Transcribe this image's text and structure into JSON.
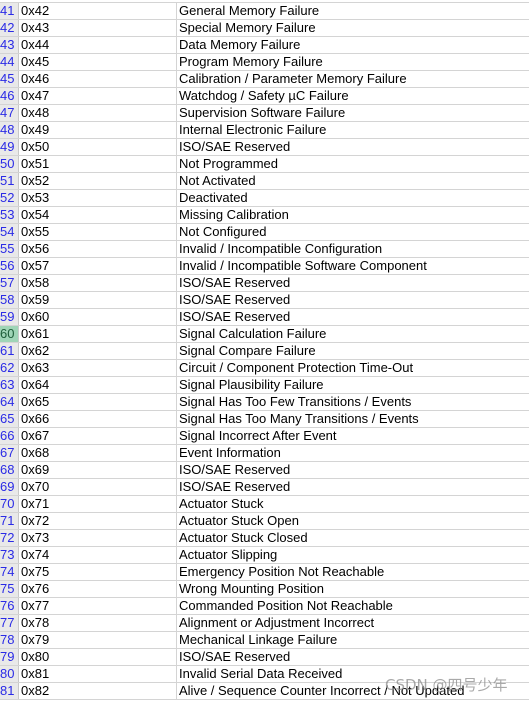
{
  "selected_row": "60",
  "colors": {
    "row_header_bg": "#e9e9e9",
    "row_number": "#2a2ae6",
    "selected_row_header": "#9fd5b7",
    "gridline": "#d4d4d4"
  },
  "rows": [
    [
      "41",
      "0x42",
      "General Memory Failure"
    ],
    [
      "42",
      "0x43",
      "Special Memory Failure"
    ],
    [
      "43",
      "0x44",
      "Data Memory Failure"
    ],
    [
      "44",
      "0x45",
      "Program Memory Failure"
    ],
    [
      "45",
      "0x46",
      "Calibration / Parameter Memory Failure"
    ],
    [
      "46",
      "0x47",
      "Watchdog / Safety µC Failure"
    ],
    [
      "47",
      "0x48",
      "Supervision Software Failure"
    ],
    [
      "48",
      "0x49",
      "Internal Electronic Failure"
    ],
    [
      "49",
      "0x50",
      "ISO/SAE Reserved"
    ],
    [
      "50",
      "0x51",
      "Not Programmed"
    ],
    [
      "51",
      "0x52",
      "Not Activated"
    ],
    [
      "52",
      "0x53",
      "Deactivated"
    ],
    [
      "53",
      "0x54",
      "Missing Calibration"
    ],
    [
      "54",
      "0x55",
      "Not Configured"
    ],
    [
      "55",
      "0x56",
      "Invalid / Incompatible Configuration"
    ],
    [
      "56",
      "0x57",
      "Invalid / Incompatible Software Component"
    ],
    [
      "57",
      "0x58",
      "ISO/SAE Reserved"
    ],
    [
      "58",
      "0x59",
      "ISO/SAE Reserved"
    ],
    [
      "59",
      "0x60",
      "ISO/SAE Reserved"
    ],
    [
      "60",
      "0x61",
      "Signal Calculation Failure"
    ],
    [
      "61",
      "0x62",
      "Signal Compare Failure"
    ],
    [
      "62",
      "0x63",
      "Circuit / Component Protection Time-Out"
    ],
    [
      "63",
      "0x64",
      "Signal Plausibility Failure"
    ],
    [
      "64",
      "0x65",
      "Signal Has Too Few Transitions / Events"
    ],
    [
      "65",
      "0x66",
      "Signal Has Too Many Transitions / Events"
    ],
    [
      "66",
      "0x67",
      "Signal Incorrect After Event"
    ],
    [
      "67",
      "0x68",
      "Event Information"
    ],
    [
      "68",
      "0x69",
      "ISO/SAE Reserved"
    ],
    [
      "69",
      "0x70",
      "ISO/SAE Reserved"
    ],
    [
      "70",
      "0x71",
      "Actuator Stuck"
    ],
    [
      "71",
      "0x72",
      "Actuator Stuck Open"
    ],
    [
      "72",
      "0x73",
      "Actuator Stuck Closed"
    ],
    [
      "73",
      "0x74",
      "Actuator Slipping"
    ],
    [
      "74",
      "0x75",
      "Emergency Position Not Reachable"
    ],
    [
      "75",
      "0x76",
      "Wrong Mounting Position"
    ],
    [
      "76",
      "0x77",
      "Commanded Position Not Reachable"
    ],
    [
      "77",
      "0x78",
      "Alignment or Adjustment Incorrect"
    ],
    [
      "78",
      "0x79",
      "Mechanical Linkage Failure"
    ],
    [
      "79",
      "0x80",
      "ISO/SAE Reserved"
    ],
    [
      "80",
      "0x81",
      "Invalid Serial Data Received"
    ],
    [
      "81",
      "0x82",
      "Alive / Sequence Counter Incorrect / Not Updated"
    ]
  ],
  "watermark": "CSDN @四号少年"
}
